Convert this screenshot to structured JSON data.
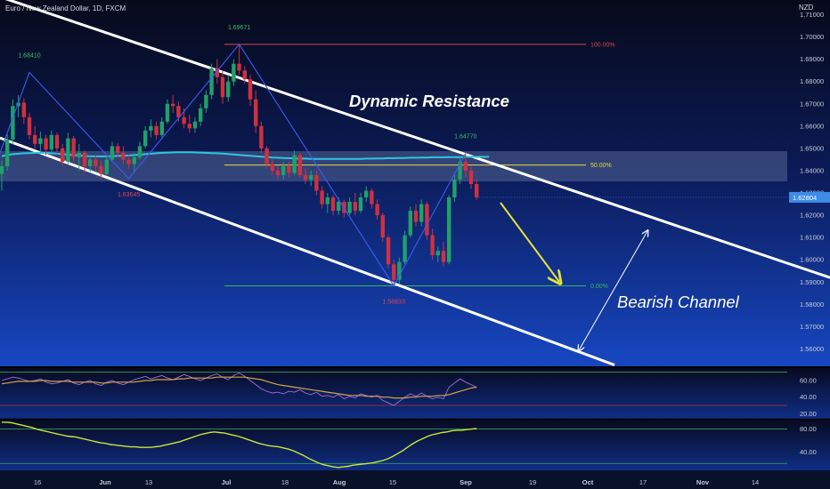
{
  "header": {
    "title": "Euro / New Zealand Dollar, 1D, FXCM",
    "currency": "NZD"
  },
  "colors": {
    "up": "#21a06a",
    "down": "#d0303f",
    "channel": "#ffffff",
    "zigzag": "#3d5cf5",
    "ma": "#2ec5e3",
    "fib100": "#d9454d",
    "fib50": "#e8d84a",
    "fib0": "#35b55a",
    "arrow": "#e8e23c",
    "price_tag": "#3c8ce8"
  },
  "chart_data": [
    {
      "type": "candlestick",
      "symbol": "Euro / New Zealand Dollar, 1D, FXCM",
      "y_axis": {
        "unit": "NZD",
        "range": [
          1.553,
          1.716
        ],
        "ticks": [
          "1.71000",
          "1.70000",
          "1.69000",
          "1.68000",
          "1.67000",
          "1.66000",
          "1.65000",
          "1.64000",
          "1.63000",
          "1.62000",
          "1.61000",
          "1.60000",
          "1.59000",
          "1.58000",
          "1.57000",
          "1.56000"
        ]
      },
      "x_axis": {
        "ticks": [
          "16",
          "Jun",
          "13",
          "Jul",
          "18",
          "Aug",
          "15",
          "Sep",
          "19",
          "Oct",
          "17",
          "Nov",
          "14"
        ]
      },
      "current_price": "1.62804",
      "candles": [
        {
          "o": 1.6385,
          "h": 1.6445,
          "l": 1.631,
          "c": 1.642
        },
        {
          "o": 1.642,
          "h": 1.6565,
          "l": 1.64,
          "c": 1.654
        },
        {
          "o": 1.654,
          "h": 1.672,
          "l": 1.652,
          "c": 1.669
        },
        {
          "o": 1.669,
          "h": 1.674,
          "l": 1.664,
          "c": 1.6705
        },
        {
          "o": 1.6705,
          "h": 1.6725,
          "l": 1.661,
          "c": 1.664
        },
        {
          "o": 1.664,
          "h": 1.666,
          "l": 1.654,
          "c": 1.656
        },
        {
          "o": 1.656,
          "h": 1.66,
          "l": 1.65,
          "c": 1.652
        },
        {
          "o": 1.652,
          "h": 1.6575,
          "l": 1.648,
          "c": 1.6545
        },
        {
          "o": 1.6545,
          "h": 1.656,
          "l": 1.647,
          "c": 1.6495
        },
        {
          "o": 1.6495,
          "h": 1.658,
          "l": 1.6485,
          "c": 1.656
        },
        {
          "o": 1.656,
          "h": 1.657,
          "l": 1.647,
          "c": 1.65
        },
        {
          "o": 1.65,
          "h": 1.652,
          "l": 1.642,
          "c": 1.644
        },
        {
          "o": 1.644,
          "h": 1.657,
          "l": 1.643,
          "c": 1.6545
        },
        {
          "o": 1.6545,
          "h": 1.6555,
          "l": 1.644,
          "c": 1.646
        },
        {
          "o": 1.646,
          "h": 1.652,
          "l": 1.64,
          "c": 1.648
        },
        {
          "o": 1.648,
          "h": 1.649,
          "l": 1.639,
          "c": 1.642
        },
        {
          "o": 1.642,
          "h": 1.647,
          "l": 1.6395,
          "c": 1.645
        },
        {
          "o": 1.645,
          "h": 1.647,
          "l": 1.64,
          "c": 1.642
        },
        {
          "o": 1.642,
          "h": 1.6445,
          "l": 1.6365,
          "c": 1.6385
        },
        {
          "o": 1.6385,
          "h": 1.647,
          "l": 1.638,
          "c": 1.645
        },
        {
          "o": 1.645,
          "h": 1.653,
          "l": 1.644,
          "c": 1.651
        },
        {
          "o": 1.651,
          "h": 1.6525,
          "l": 1.646,
          "c": 1.648
        },
        {
          "o": 1.648,
          "h": 1.651,
          "l": 1.643,
          "c": 1.645
        },
        {
          "o": 1.645,
          "h": 1.647,
          "l": 1.641,
          "c": 1.643
        },
        {
          "o": 1.643,
          "h": 1.648,
          "l": 1.64,
          "c": 1.646
        },
        {
          "o": 1.646,
          "h": 1.653,
          "l": 1.645,
          "c": 1.651
        },
        {
          "o": 1.651,
          "h": 1.66,
          "l": 1.65,
          "c": 1.658
        },
        {
          "o": 1.658,
          "h": 1.663,
          "l": 1.655,
          "c": 1.66
        },
        {
          "o": 1.66,
          "h": 1.662,
          "l": 1.654,
          "c": 1.656
        },
        {
          "o": 1.656,
          "h": 1.664,
          "l": 1.655,
          "c": 1.662
        },
        {
          "o": 1.662,
          "h": 1.672,
          "l": 1.661,
          "c": 1.67
        },
        {
          "o": 1.67,
          "h": 1.674,
          "l": 1.666,
          "c": 1.669
        },
        {
          "o": 1.669,
          "h": 1.671,
          "l": 1.662,
          "c": 1.664
        },
        {
          "o": 1.664,
          "h": 1.668,
          "l": 1.659,
          "c": 1.661
        },
        {
          "o": 1.661,
          "h": 1.665,
          "l": 1.657,
          "c": 1.659
        },
        {
          "o": 1.659,
          "h": 1.664,
          "l": 1.657,
          "c": 1.662
        },
        {
          "o": 1.662,
          "h": 1.67,
          "l": 1.66,
          "c": 1.668
        },
        {
          "o": 1.668,
          "h": 1.676,
          "l": 1.666,
          "c": 1.674
        },
        {
          "o": 1.674,
          "h": 1.688,
          "l": 1.672,
          "c": 1.686
        },
        {
          "o": 1.686,
          "h": 1.69,
          "l": 1.679,
          "c": 1.682
        },
        {
          "o": 1.682,
          "h": 1.685,
          "l": 1.67,
          "c": 1.673
        },
        {
          "o": 1.673,
          "h": 1.683,
          "l": 1.671,
          "c": 1.68
        },
        {
          "o": 1.68,
          "h": 1.69,
          "l": 1.678,
          "c": 1.688
        },
        {
          "o": 1.688,
          "h": 1.6967,
          "l": 1.683,
          "c": 1.685
        },
        {
          "o": 1.685,
          "h": 1.687,
          "l": 1.679,
          "c": 1.681
        },
        {
          "o": 1.681,
          "h": 1.683,
          "l": 1.669,
          "c": 1.672
        },
        {
          "o": 1.672,
          "h": 1.676,
          "l": 1.657,
          "c": 1.66
        },
        {
          "o": 1.66,
          "h": 1.662,
          "l": 1.648,
          "c": 1.65
        },
        {
          "o": 1.65,
          "h": 1.651,
          "l": 1.641,
          "c": 1.643
        },
        {
          "o": 1.643,
          "h": 1.645,
          "l": 1.638,
          "c": 1.64
        },
        {
          "o": 1.64,
          "h": 1.642,
          "l": 1.636,
          "c": 1.638
        },
        {
          "o": 1.638,
          "h": 1.644,
          "l": 1.636,
          "c": 1.642
        },
        {
          "o": 1.642,
          "h": 1.644,
          "l": 1.637,
          "c": 1.639
        },
        {
          "o": 1.639,
          "h": 1.649,
          "l": 1.638,
          "c": 1.647
        },
        {
          "o": 1.647,
          "h": 1.648,
          "l": 1.637,
          "c": 1.638
        },
        {
          "o": 1.638,
          "h": 1.641,
          "l": 1.634,
          "c": 1.636
        },
        {
          "o": 1.636,
          "h": 1.64,
          "l": 1.633,
          "c": 1.638
        },
        {
          "o": 1.638,
          "h": 1.64,
          "l": 1.629,
          "c": 1.631
        },
        {
          "o": 1.631,
          "h": 1.633,
          "l": 1.623,
          "c": 1.625
        },
        {
          "o": 1.625,
          "h": 1.63,
          "l": 1.621,
          "c": 1.628
        },
        {
          "o": 1.628,
          "h": 1.629,
          "l": 1.62,
          "c": 1.622
        },
        {
          "o": 1.622,
          "h": 1.628,
          "l": 1.62,
          "c": 1.626
        },
        {
          "o": 1.626,
          "h": 1.627,
          "l": 1.619,
          "c": 1.621
        },
        {
          "o": 1.621,
          "h": 1.628,
          "l": 1.62,
          "c": 1.626
        },
        {
          "o": 1.626,
          "h": 1.63,
          "l": 1.62,
          "c": 1.622
        },
        {
          "o": 1.622,
          "h": 1.63,
          "l": 1.621,
          "c": 1.628
        },
        {
          "o": 1.628,
          "h": 1.633,
          "l": 1.626,
          "c": 1.631
        },
        {
          "o": 1.631,
          "h": 1.632,
          "l": 1.623,
          "c": 1.625
        },
        {
          "o": 1.625,
          "h": 1.627,
          "l": 1.618,
          "c": 1.62
        },
        {
          "o": 1.62,
          "h": 1.621,
          "l": 1.608,
          "c": 1.61
        },
        {
          "o": 1.61,
          "h": 1.611,
          "l": 1.596,
          "c": 1.598
        },
        {
          "o": 1.598,
          "h": 1.6,
          "l": 1.5883,
          "c": 1.591
        },
        {
          "o": 1.591,
          "h": 1.601,
          "l": 1.589,
          "c": 1.599
        },
        {
          "o": 1.599,
          "h": 1.613,
          "l": 1.598,
          "c": 1.611
        },
        {
          "o": 1.611,
          "h": 1.624,
          "l": 1.61,
          "c": 1.622
        },
        {
          "o": 1.622,
          "h": 1.625,
          "l": 1.615,
          "c": 1.617
        },
        {
          "o": 1.617,
          "h": 1.627,
          "l": 1.615,
          "c": 1.625
        },
        {
          "o": 1.625,
          "h": 1.626,
          "l": 1.609,
          "c": 1.611
        },
        {
          "o": 1.611,
          "h": 1.614,
          "l": 1.6,
          "c": 1.602
        },
        {
          "o": 1.602,
          "h": 1.606,
          "l": 1.599,
          "c": 1.604
        },
        {
          "o": 1.604,
          "h": 1.608,
          "l": 1.597,
          "c": 1.599
        },
        {
          "o": 1.599,
          "h": 1.629,
          "l": 1.598,
          "c": 1.628
        },
        {
          "o": 1.628,
          "h": 1.638,
          "l": 1.626,
          "c": 1.636
        },
        {
          "o": 1.636,
          "h": 1.646,
          "l": 1.634,
          "c": 1.644
        },
        {
          "o": 1.644,
          "h": 1.6477,
          "l": 1.637,
          "c": 1.64
        },
        {
          "o": 1.64,
          "h": 1.642,
          "l": 1.632,
          "c": 1.634
        },
        {
          "o": 1.634,
          "h": 1.636,
          "l": 1.627,
          "c": 1.628
        }
      ],
      "moving_average": [
        1.6465,
        1.647,
        1.6474,
        1.6476,
        1.6478,
        1.6479,
        1.648,
        1.648,
        1.648,
        1.6478,
        1.6476,
        1.6474,
        1.6472,
        1.647,
        1.6468,
        1.6466,
        1.6465,
        1.6464,
        1.6464,
        1.6464,
        1.6465,
        1.6466,
        1.6467,
        1.6468,
        1.647,
        1.6472,
        1.6474,
        1.6476,
        1.6478,
        1.648,
        1.6481,
        1.6482,
        1.6483,
        1.6483,
        1.6483,
        1.6482,
        1.6481,
        1.648,
        1.6479,
        1.6478,
        1.6477,
        1.6475,
        1.6473,
        1.6471,
        1.6469,
        1.6467,
        1.6465,
        1.6463,
        1.6461,
        1.6459,
        1.6458,
        1.6457,
        1.6456,
        1.6455,
        1.6454,
        1.6454,
        1.6453,
        1.6453,
        1.6453,
        1.6453,
        1.6453,
        1.6453,
        1.6453,
        1.6453,
        1.6453,
        1.6453,
        1.6454,
        1.6454,
        1.6455,
        1.6455,
        1.6456,
        1.6456,
        1.6457,
        1.6457,
        1.6458,
        1.6458,
        1.6459,
        1.6459,
        1.646,
        1.646,
        1.646,
        1.6461,
        1.6461,
        1.6461,
        1.6462,
        1.6462,
        1.6462
      ],
      "zigzag_points": [
        {
          "bar": 5,
          "price": 1.6841,
          "label": "1.68410"
        },
        {
          "bar": 23,
          "price": 1.63645,
          "label": "1.63645"
        },
        {
          "bar": 43,
          "price": 1.69671,
          "label": "1.69671"
        },
        {
          "bar": 71,
          "price": 1.58833,
          "label": "1.58833"
        },
        {
          "bar": 84,
          "price": 1.6477,
          "label": "1.64770"
        }
      ],
      "fibonacci": [
        {
          "label": "100.00%",
          "price": 1.69671
        },
        {
          "label": "50.00%",
          "price": 1.64252
        },
        {
          "label": "0.00%",
          "price": 1.58833
        }
      ],
      "annotations": [
        "Dynamic Resistance",
        "Bearish Channel"
      ]
    },
    {
      "type": "line",
      "name": "oscillator-1",
      "y_axis": {
        "ticks": [
          "60.00",
          "40.00",
          "20.00"
        ]
      },
      "series": [
        {
          "values": [
            60,
            62,
            64,
            63,
            61,
            59,
            60,
            62,
            58,
            56,
            57,
            59,
            61,
            57,
            55,
            58,
            60,
            56,
            54,
            58,
            60,
            57,
            55,
            58,
            61,
            63,
            65,
            62,
            64,
            66,
            63,
            61,
            64,
            67,
            65,
            62,
            60,
            63,
            66,
            68,
            64,
            61,
            66,
            69,
            65,
            60,
            55,
            50,
            47,
            45,
            46,
            44,
            47,
            46,
            49,
            45,
            43,
            46,
            41,
            42,
            40,
            43,
            38,
            41,
            39,
            44,
            42,
            40,
            42,
            36,
            33,
            30,
            35,
            40,
            44,
            41,
            45,
            41,
            38,
            40,
            38,
            52,
            57,
            62,
            58,
            55,
            52
          ]
        },
        {
          "values": [
            56,
            57,
            58,
            59,
            59,
            59,
            59,
            60,
            60,
            59,
            59,
            59,
            59,
            58,
            58,
            58,
            58,
            58,
            57,
            57,
            58,
            58,
            58,
            58,
            58,
            59,
            60,
            60,
            61,
            61,
            61,
            61,
            62,
            62,
            63,
            63,
            63,
            63,
            63,
            64,
            64,
            64,
            64,
            64,
            64,
            63,
            62,
            61,
            59,
            57,
            55,
            54,
            53,
            52,
            51,
            50,
            49,
            48,
            47,
            46,
            45,
            44,
            43,
            42,
            42,
            42,
            41,
            41,
            41,
            40,
            40,
            39,
            39,
            39,
            40,
            40,
            41,
            41,
            41,
            42,
            42,
            43,
            45,
            47,
            49,
            51,
            52
          ]
        }
      ]
    },
    {
      "type": "line",
      "name": "oscillator-2",
      "y_axis": {
        "ticks": [
          "80.00",
          "40.00"
        ]
      },
      "series": [
        {
          "values": [
            92,
            92,
            91,
            89,
            87,
            85,
            83,
            80,
            78,
            76,
            74,
            72,
            70,
            68,
            67,
            66,
            64,
            62,
            60,
            58,
            56,
            55,
            53,
            52,
            51,
            50,
            49,
            49,
            48,
            48,
            48,
            49,
            50,
            52,
            54,
            56,
            58,
            61,
            64,
            67,
            70,
            72,
            74,
            75,
            74,
            73,
            71,
            69,
            67,
            64,
            61,
            58,
            55,
            53,
            51,
            50,
            49,
            47,
            45,
            42,
            38,
            34,
            29,
            25,
            21,
            18,
            16,
            14,
            13,
            14,
            15,
            17,
            18,
            19,
            20,
            21,
            23,
            25,
            28,
            32,
            37,
            42,
            48,
            54,
            59,
            63,
            67,
            70,
            72,
            74,
            75,
            77,
            78,
            78,
            79,
            80,
            81
          ]
        }
      ]
    }
  ]
}
